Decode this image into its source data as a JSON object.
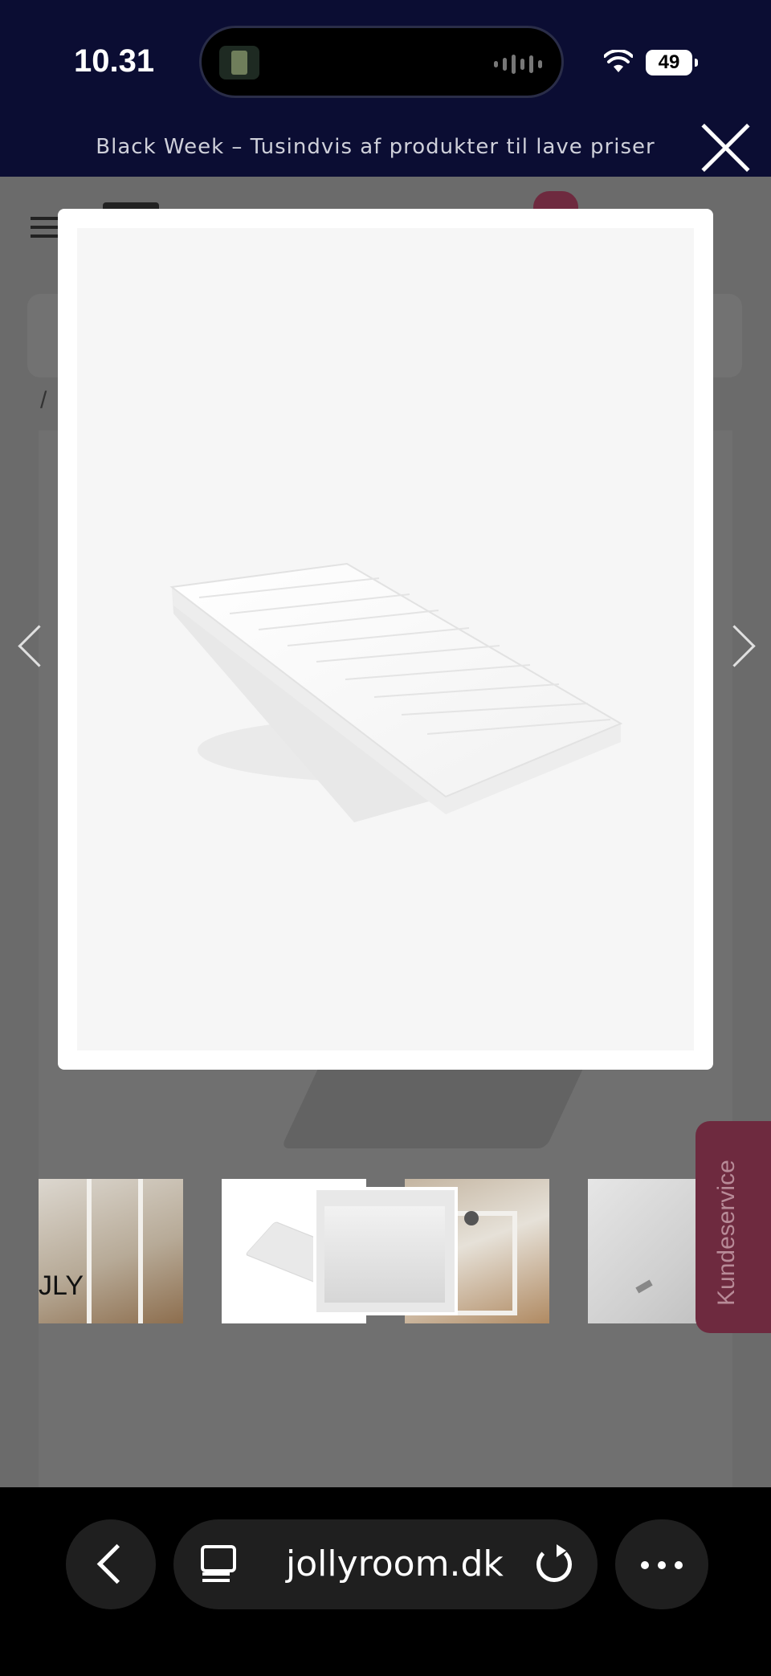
{
  "status_bar": {
    "time": "10.31",
    "battery": "49"
  },
  "promo": {
    "text": "Black Week – Tusindvis af produkter til lave priser"
  },
  "product": {
    "brand": "JLY"
  },
  "kundeservice": {
    "label": "Kundeservice"
  },
  "browser": {
    "url": "jollyroom.dk"
  },
  "icons": {
    "close": "close-icon",
    "prev": "chevron-left-icon",
    "next": "chevron-right-icon",
    "back": "chevron-left-icon",
    "tabs": "tabs-icon",
    "reload": "reload-icon",
    "more": "ellipsis-icon",
    "wifi": "wifi-icon"
  },
  "colors": {
    "status_bg": "#0b0d33",
    "overlay": "#666666",
    "kundeservice": "#6e2a3f",
    "browser_bg": "#000000"
  }
}
